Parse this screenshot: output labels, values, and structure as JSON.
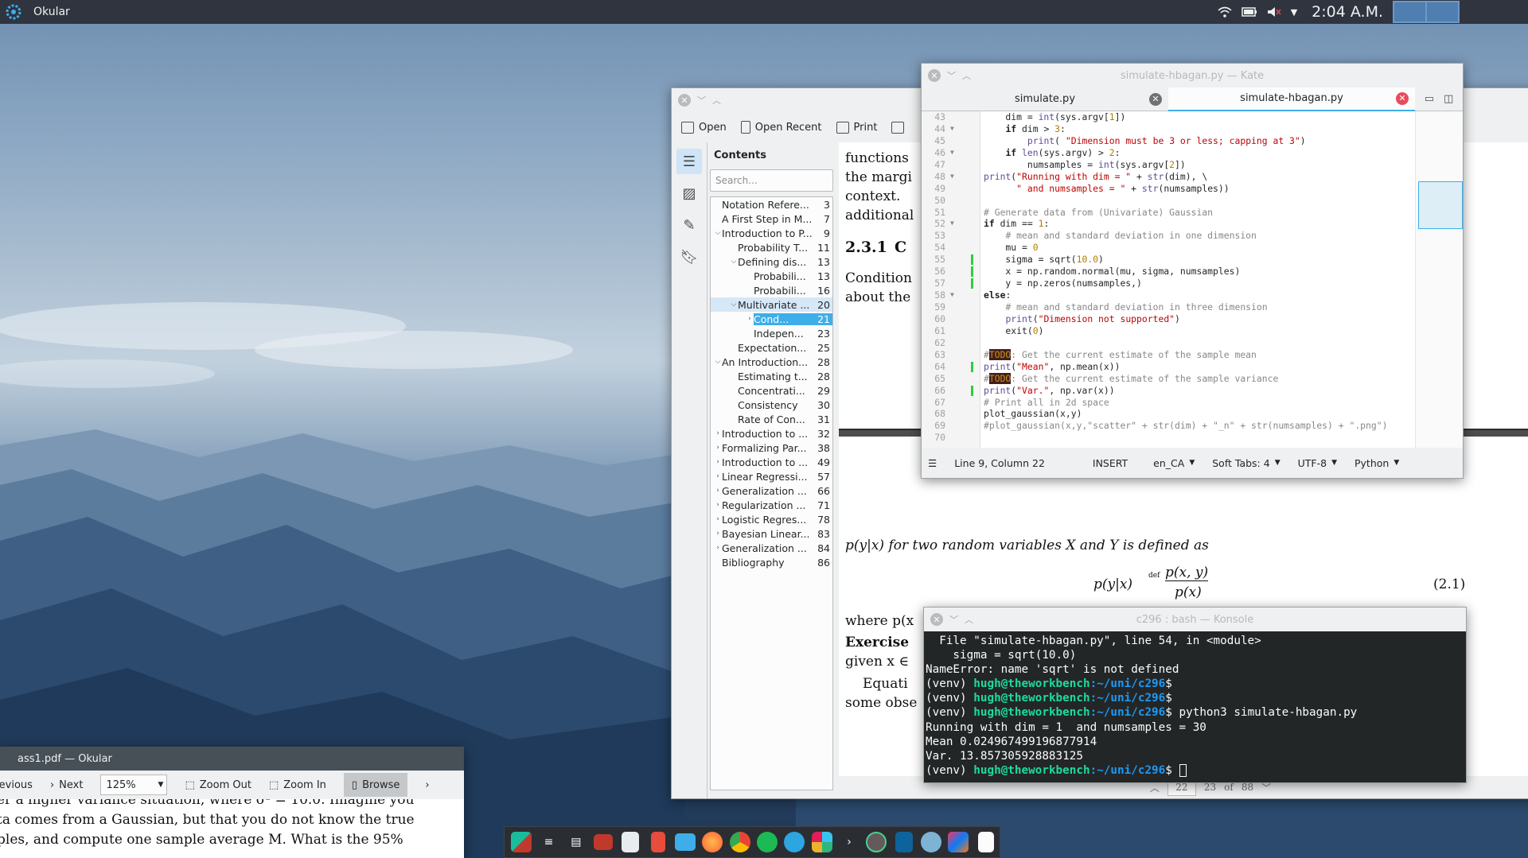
{
  "panel": {
    "app_title": "Okular",
    "clock": "2:04 A.M."
  },
  "okular": {
    "toolbar": {
      "open": "Open",
      "open_recent": "Open Recent",
      "print": "Print"
    },
    "contents_heading": "Contents",
    "search_placeholder": "Search...",
    "toc": [
      {
        "title": "Notation Refere...",
        "page": "3",
        "indent": 0,
        "arrow": ""
      },
      {
        "title": "A First Step in M...",
        "page": "7",
        "indent": 0,
        "arrow": ""
      },
      {
        "title": "Introduction to P...",
        "page": "9",
        "indent": 0,
        "arrow": "v"
      },
      {
        "title": "Probability T...",
        "page": "11",
        "indent": 1,
        "arrow": ""
      },
      {
        "title": "Defining dis...",
        "page": "13",
        "indent": 1,
        "arrow": "v"
      },
      {
        "title": "Probabili...",
        "page": "13",
        "indent": 2,
        "arrow": ""
      },
      {
        "title": "Probabili...",
        "page": "16",
        "indent": 2,
        "arrow": ""
      },
      {
        "title": "Multivariate ...",
        "page": "20",
        "indent": 1,
        "arrow": "v",
        "hl": true
      },
      {
        "title": "Cond...",
        "page": "21",
        "indent": 2,
        "arrow": ">",
        "sel": true
      },
      {
        "title": "Indepen...",
        "page": "23",
        "indent": 2,
        "arrow": ""
      },
      {
        "title": "Expectation...",
        "page": "25",
        "indent": 1,
        "arrow": ""
      },
      {
        "title": "An Introduction...",
        "page": "28",
        "indent": 0,
        "arrow": "v"
      },
      {
        "title": "Estimating t...",
        "page": "28",
        "indent": 1,
        "arrow": ""
      },
      {
        "title": "Concentrati...",
        "page": "29",
        "indent": 1,
        "arrow": ""
      },
      {
        "title": "Consistency",
        "page": "30",
        "indent": 1,
        "arrow": ""
      },
      {
        "title": "Rate of Con...",
        "page": "31",
        "indent": 1,
        "arrow": ""
      },
      {
        "title": "Introduction to ...",
        "page": "32",
        "indent": 0,
        "arrow": ">"
      },
      {
        "title": "Formalizing Par...",
        "page": "38",
        "indent": 0,
        "arrow": ">"
      },
      {
        "title": "Introduction to ...",
        "page": "49",
        "indent": 0,
        "arrow": ">"
      },
      {
        "title": "Linear Regressi...",
        "page": "57",
        "indent": 0,
        "arrow": ">"
      },
      {
        "title": "Generalization ...",
        "page": "66",
        "indent": 0,
        "arrow": ">"
      },
      {
        "title": "Regularization ...",
        "page": "71",
        "indent": 0,
        "arrow": ">"
      },
      {
        "title": "Logistic Regres...",
        "page": "78",
        "indent": 0,
        "arrow": ">"
      },
      {
        "title": "Bayesian Linear...",
        "page": "83",
        "indent": 0,
        "arrow": ">"
      },
      {
        "title": "Generalization ...",
        "page": "84",
        "indent": 0,
        "arrow": ">"
      },
      {
        "title": "Bibliography",
        "page": "86",
        "indent": 0,
        "arrow": ""
      }
    ],
    "page_text": {
      "l1": "functions",
      "l2": "the margi",
      "l3": "context.",
      "l4": "additional",
      "section": "2.3.1",
      "section_letter": "C",
      "l5": "Condition",
      "l6": "about the",
      "def_line": "p(y|x) for two random variables X and Y is defined as",
      "eq_lhs": "p(y|x)",
      "eq_def": "def",
      "eq_num": "p(x, y)",
      "eq_den": "p(x)",
      "eq_tag": "(2.1)",
      "where": "where p(x",
      "exercise": "Exercise",
      "given": "given x ∈",
      "equati": "Equati",
      "some_obs": "some obse"
    },
    "pagebar": {
      "current": "22",
      "next": "23",
      "of": "of",
      "total": "88"
    }
  },
  "kate": {
    "title": "simulate-hbagan.py — Kate",
    "tabs": [
      "simulate.py",
      "simulate-hbagan.py"
    ],
    "status": {
      "position": "Line 9, Column 22",
      "mode": "INSERT",
      "lang": "en_CA",
      "tabs": "Soft Tabs: 4",
      "encoding": "UTF-8",
      "syntax": "Python"
    }
  },
  "konsole": {
    "title": "c296 : bash — Konsole",
    "lines": [
      {
        "t": "  File \"simulate-hbagan.py\", line 54, in <module>"
      },
      {
        "t": "    sigma = sqrt(10.0)"
      },
      {
        "t": "NameError: name 'sqrt' is not defined"
      },
      {
        "prompt": true,
        "cmd": ""
      },
      {
        "prompt": true,
        "cmd": ""
      },
      {
        "prompt": true,
        "cmd": " python3 simulate-hbagan.py"
      },
      {
        "t": "Running with dim = 1  and numsamples = 30"
      },
      {
        "t": "Mean 0.024967499196877914"
      },
      {
        "t": "Var. 13.857305928883125"
      },
      {
        "prompt": true,
        "cmd": " ",
        "cursor": true
      }
    ],
    "prompt_venv": "(venv) ",
    "prompt_user": "hugh@theworkbench",
    "prompt_path": ":~/uni/c296",
    "prompt_end": "$"
  },
  "okular2": {
    "title": "ass1.pdf — Okular",
    "toolbar": {
      "previous": "Previous",
      "next": "Next",
      "zoom": "125%",
      "zoom_out": "Zoom Out",
      "zoom_in": "Zoom In",
      "browse": "Browse"
    },
    "lines": [
      "er a higher variance situation, where σ² = 10.0.  Imagine you",
      "ta comes from a Gaussian, but that you do not know the true",
      "ples, and compute one sample average M.  What is the 95%"
    ]
  },
  "colors": {
    "accent": "#3daee9",
    "panel": "#2f343f",
    "term_bg": "#232627",
    "prompt_user": "#1cdc9a",
    "prompt_path": "#1d99f3"
  }
}
